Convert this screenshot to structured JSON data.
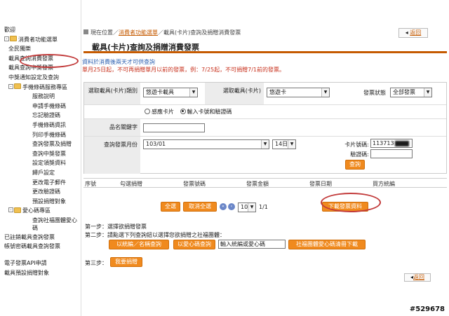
{
  "sidebar": {
    "items": [
      {
        "label": "歡迎",
        "level": 0
      },
      {
        "label": "消費者功能選單",
        "level": 0,
        "folder": true,
        "expander": "-"
      },
      {
        "label": "全民獨樂",
        "level": 1
      },
      {
        "label": "載具查詢消費發票",
        "level": 1,
        "highlight": true
      },
      {
        "label": "載具查詢中獎發票",
        "level": 1
      },
      {
        "label": "中獎通知設定及查詢",
        "level": 1
      },
      {
        "label": "手機條碼服務專區",
        "level": 1,
        "folder": true,
        "expander": "-"
      },
      {
        "label": "服務說明",
        "level": 2
      },
      {
        "label": "申請手機條碼",
        "level": 2
      },
      {
        "label": "忘記驗證碼",
        "level": 2
      },
      {
        "label": "手機條碼資訊",
        "level": 2
      },
      {
        "label": "列印手機條碼",
        "level": 2
      },
      {
        "label": "查詢發票及捐贈",
        "level": 2
      },
      {
        "label": "查詢中獎發票",
        "level": 2
      },
      {
        "label": "設定領獎資料",
        "level": 2
      },
      {
        "label": "歸戶設定",
        "level": 2
      },
      {
        "label": "更改電子郵件",
        "level": 2
      },
      {
        "label": "更改驗證碼",
        "level": 2
      },
      {
        "label": "預設捐贈對象",
        "level": 2
      },
      {
        "label": "愛心碼專區",
        "level": 1,
        "folder": true,
        "expander": "-"
      },
      {
        "label": "查詢社福團體愛心碼",
        "level": 2,
        "wrap": true
      },
      {
        "label": "已註銷載具查詢發票",
        "level": 0
      },
      {
        "label": "帳號密碼載具查詢發票",
        "level": 0,
        "wrap": true
      },
      {
        "label": "電子發票API申請",
        "level": 0
      },
      {
        "label": "載具預設捐贈對象",
        "level": 0
      }
    ]
  },
  "breadcrumb": {
    "prefix": "現在位置／",
    "link": "消費者功能選單",
    "rest": "／載具(卡片)查詢及捐贈消費發票"
  },
  "back_label": "返回",
  "page_title": "載具(卡片)查詢及捐贈消費發票",
  "notice": {
    "line1": "資料於消費後兩天才可供查詢",
    "line2": "單月25日起，不可再捐贈單月以前的發票，例：7/25起，不可捐贈7/1前的發票。"
  },
  "form": {
    "carrier_type_label": "選取載具(卡片)類別",
    "carrier_type_value": "悠遊卡載具",
    "carrier_label": "選取載具(卡片)",
    "carrier_value": "悠遊卡",
    "status_label": "發票狀態",
    "status_value": "全部發票",
    "radio_phys_label": "感應卡片",
    "radio_input_label": "輸入卡號和驗證碼",
    "name_label": "品名關鍵字",
    "name_value": "",
    "month_label": "查詢發票月份",
    "month_value": "103/01",
    "day_value": "14日",
    "card_no_label": "卡片號碼:",
    "card_no_value": "113713",
    "verify_label": "驗證碼:",
    "verify_value": "",
    "query_button": "查詢"
  },
  "table": {
    "headers": [
      "序號",
      "勾選捐贈",
      "發票號碼",
      "發票金額",
      "發票日期",
      "買方統編"
    ]
  },
  "pager": {
    "select_all": "全選",
    "cancel_all": "取消全選",
    "page_size": "10",
    "page_info": "1/1",
    "download": "下載發票資料"
  },
  "steps": {
    "step1": "第一步：選擇欲捐贈發票",
    "step2": "第二步：請點選下列查詢鈕以選擇您欲捐贈之社福團體：",
    "btn_by_id": "以統編／名稱查詢",
    "btn_by_code": "以愛心碼查詢",
    "code_placeholder": "輸入統編或愛心碼",
    "btn_download_list": "社福團體愛心碼清冊下載",
    "step3": "第三步：",
    "btn_confirm": "我要捐贈"
  },
  "stamp": "#529678",
  "colors": {
    "accent": "#f08a1e",
    "title_rule": "#c55a00",
    "notice_red": "#c8321e",
    "notice_blue": "#2b5fb0",
    "annotation_circle": "#c23a3a"
  }
}
